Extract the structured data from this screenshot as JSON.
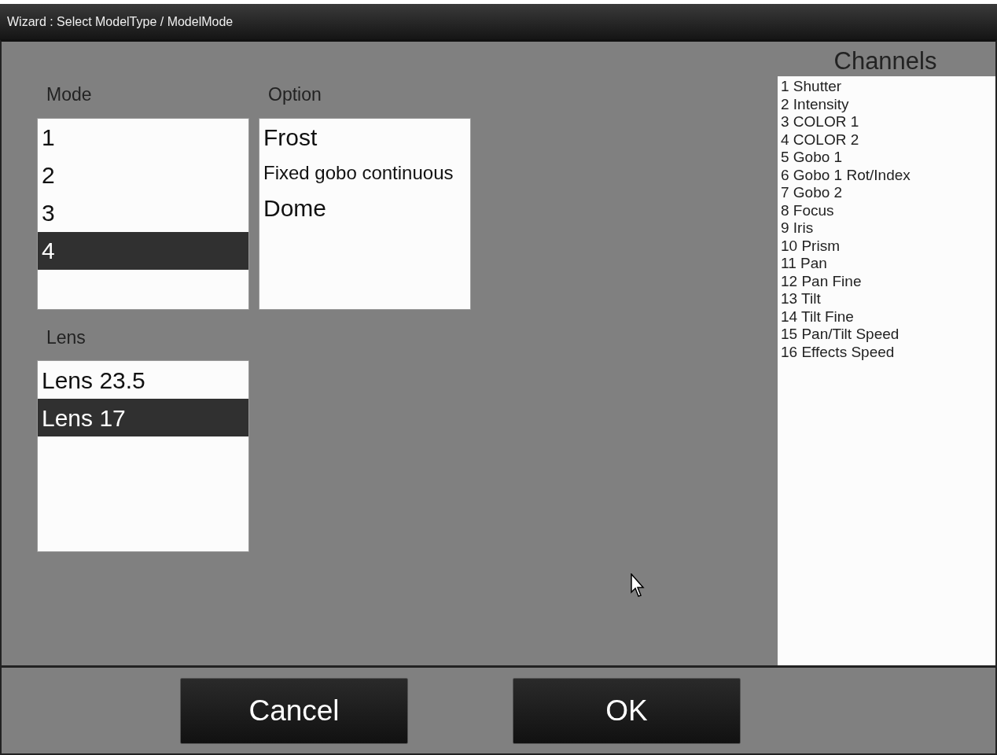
{
  "window": {
    "title": "Wizard : Select ModelType / ModelMode"
  },
  "mode": {
    "label": "Mode",
    "items": [
      {
        "text": "1",
        "selected": false
      },
      {
        "text": "2",
        "selected": false
      },
      {
        "text": "3",
        "selected": false
      },
      {
        "text": "4",
        "selected": true
      }
    ]
  },
  "option": {
    "label": "Option",
    "items": [
      {
        "text": "Frost",
        "kind": "large"
      },
      {
        "text": "Fixed gobo continuous",
        "kind": "small"
      },
      {
        "text": "Dome",
        "kind": "large"
      }
    ]
  },
  "lens": {
    "label": "Lens",
    "items": [
      {
        "text": "Lens 23.5",
        "selected": false
      },
      {
        "text": "Lens 17",
        "selected": true
      }
    ]
  },
  "channels": {
    "title": "Channels",
    "items": [
      "1 Shutter",
      "2 Intensity",
      "3 COLOR 1",
      "4 COLOR 2",
      "5 Gobo 1",
      "6 Gobo 1 Rot/Index",
      "7 Gobo 2",
      "8 Focus",
      "9 Iris",
      "10 Prism",
      "11 Pan",
      "12 Pan Fine",
      "13 Tilt",
      "14 Tilt Fine",
      "15 Pan/Tilt Speed",
      "16 Effects Speed"
    ]
  },
  "buttons": [
    "Cancel",
    "OK"
  ]
}
